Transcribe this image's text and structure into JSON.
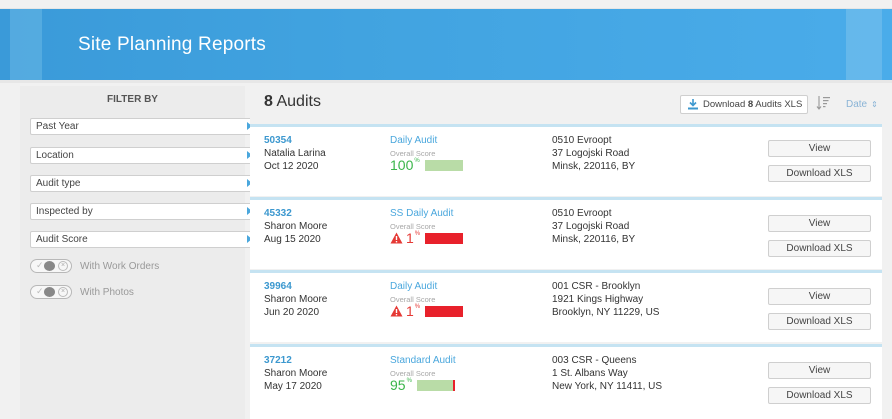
{
  "header": {
    "title": "Site Planning Reports"
  },
  "sidebar": {
    "title": "FILTER BY",
    "filters": [
      "Past Year",
      "Location",
      "Audit type",
      "Inspected by",
      "Audit Score"
    ],
    "toggles": [
      "With Work Orders",
      "With Photos"
    ]
  },
  "toolbar": {
    "count": "8",
    "count_label": " Audits",
    "download_prefix": "Download ",
    "download_count": "8",
    "download_suffix": " Audits XLS",
    "sort_label": "Date"
  },
  "audits": [
    {
      "id": "50354",
      "inspector": "Natalia Larina",
      "date": "Oct 12 2020",
      "type": "Daily Audit",
      "score_label": "Overall Score",
      "score": "100",
      "percent_sign": "%",
      "score_fraction": 1.0,
      "status": "good",
      "address": [
        "0510 Evroopt",
        "37 Logojski Road",
        "Minsk, 220116, BY"
      ],
      "view_label": "View",
      "download_label": "Download XLS"
    },
    {
      "id": "45332",
      "inspector": "Sharon Moore",
      "date": "Aug 15 2020",
      "type": "SS Daily Audit",
      "score_label": "Overall Score",
      "score": "1",
      "percent_sign": "%",
      "score_fraction": 0.01,
      "status": "bad",
      "address": [
        "0510 Evroopt",
        "37 Logojski Road",
        "Minsk, 220116, BY"
      ],
      "view_label": "View",
      "download_label": "Download XLS"
    },
    {
      "id": "39964",
      "inspector": "Sharon Moore",
      "date": "Jun 20 2020",
      "type": "Daily Audit",
      "score_label": "Overall Score",
      "score": "1",
      "percent_sign": "%",
      "score_fraction": 0.01,
      "status": "bad",
      "address": [
        "001 CSR - Brooklyn",
        "1921 Kings Highway",
        "Brooklyn, NY 11229, US"
      ],
      "view_label": "View",
      "download_label": "Download XLS"
    },
    {
      "id": "37212",
      "inspector": "Sharon Moore",
      "date": "May 17 2020",
      "type": "Standard Audit",
      "score_label": "Overall Score",
      "score": "95",
      "percent_sign": "%",
      "score_fraction": 0.95,
      "status": "good",
      "address": [
        "003 CSR - Queens",
        "1 St. Albans Way",
        "New York, NY 11411, US"
      ],
      "view_label": "View",
      "download_label": "Download XLS"
    }
  ],
  "colors": {
    "accent": "#3c98cf",
    "good": "#3ab54a",
    "bad": "#e53935",
    "header": "#41a3e0"
  }
}
